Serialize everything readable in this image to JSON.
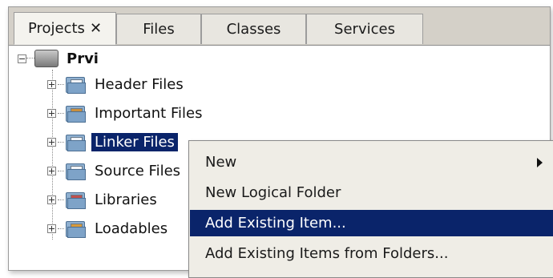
{
  "tabs": [
    {
      "label": "Projects",
      "close": "✕"
    },
    {
      "label": "Files"
    },
    {
      "label": "Classes"
    },
    {
      "label": "Services"
    }
  ],
  "tree": {
    "project": "Prvi",
    "items": [
      {
        "label": "Header Files",
        "icon": "header-files-folder-icon"
      },
      {
        "label": "Important Files",
        "icon": "important-files-folder-icon"
      },
      {
        "label": "Linker Files",
        "icon": "linker-files-folder-icon"
      },
      {
        "label": "Source Files",
        "icon": "source-files-folder-icon"
      },
      {
        "label": "Libraries",
        "icon": "libraries-folder-icon"
      },
      {
        "label": "Loadables",
        "icon": "loadables-folder-icon"
      }
    ]
  },
  "context_menu": {
    "items": [
      {
        "label": "New",
        "submenu": true
      },
      {
        "label": "New Logical Folder"
      },
      {
        "label": "Add Existing Item..."
      },
      {
        "label": "Add Existing Items from Folders..."
      }
    ],
    "highlighted": "Add Existing Item..."
  },
  "colors": {
    "selection": "#0a246a",
    "menu_bg": "#efede6",
    "tab_bg": "#d4d0c8"
  }
}
